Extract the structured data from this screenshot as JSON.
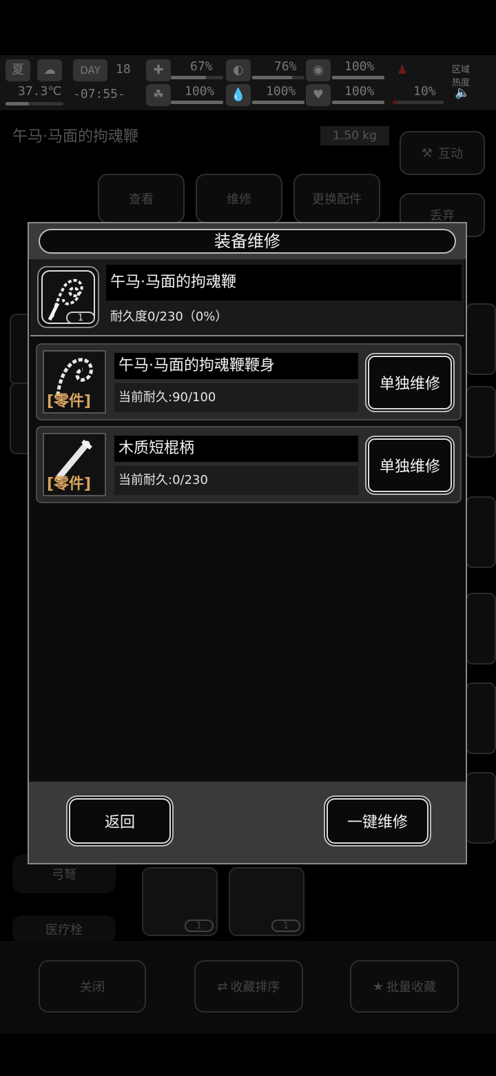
{
  "status": {
    "season": "夏",
    "temperature": "37.3℃",
    "day_label": "DAY",
    "day_number": "18",
    "time": "-07:55-",
    "stats_top": [
      "67%",
      "76%",
      "100%"
    ],
    "stats_bottom": [
      "100%",
      "100%",
      "100%",
      "10%"
    ],
    "zone_heat_label": "区域热度"
  },
  "background": {
    "item_title": "午马·马面的拘魂鞭",
    "weight": "1.50 kg",
    "interact_label": "互动",
    "discard_label": "丢弃",
    "tabs": [
      "查看",
      "维修",
      "更换配件"
    ],
    "side_labels": [
      "弓弩",
      "医疗栓"
    ],
    "bottom_buttons": [
      "关闭",
      "收藏排序",
      "批量收藏"
    ],
    "item_counts": [
      "1",
      "1"
    ]
  },
  "modal": {
    "title": "装备维修",
    "main_item": {
      "name": "午马·马面的拘魂鞭",
      "durability": "耐久度0/230（0%）",
      "count": "1"
    },
    "parts": [
      {
        "name": "午马·马面的拘魂鞭鞭身",
        "tag": "[零件]",
        "durability": "当前耐久:90/100",
        "button": "单独维修"
      },
      {
        "name": "木质短棍柄",
        "tag": "[零件]",
        "durability": "当前耐久:0/230",
        "button": "单独维修"
      }
    ],
    "back_button": "返回",
    "repair_all_button": "一键维修"
  }
}
